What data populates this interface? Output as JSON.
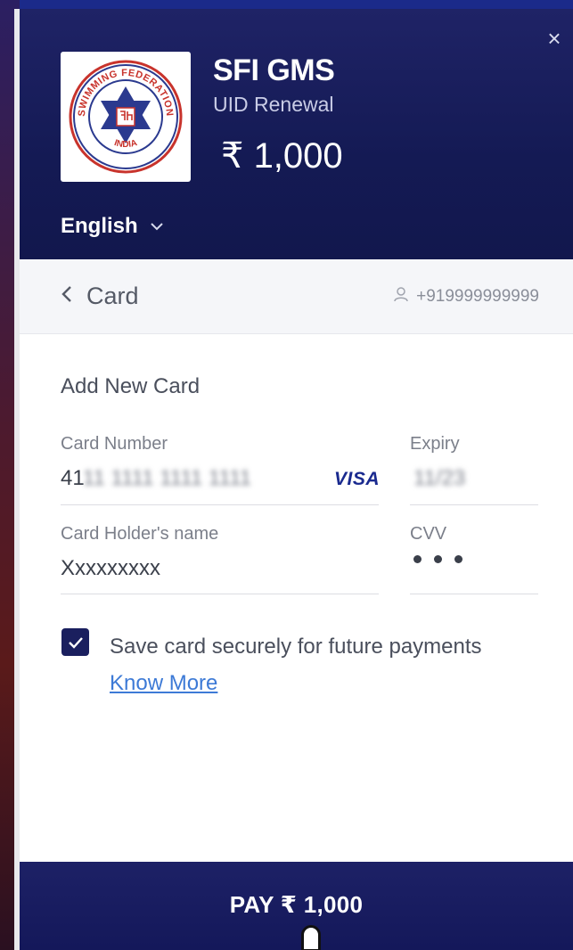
{
  "header": {
    "close_label": "×",
    "merchant_name": "SFI GMS",
    "merchant_desc": "UID Renewal",
    "amount": "₹ 1,000",
    "logo": {
      "top_text": "SWIMMING FEDERATION",
      "bottom_text": "INDIA"
    },
    "language": "English"
  },
  "method_bar": {
    "title": "Card",
    "contact": "+919999999999"
  },
  "form": {
    "section_title": "Add New Card",
    "card_number_label": "Card Number",
    "card_number_prefix": "41",
    "card_number_masked": "11 1111 1111 1111",
    "card_brand": "VISA",
    "expiry_label": "Expiry",
    "expiry_value": "11/23",
    "holder_label": "Card Holder's name",
    "holder_value": "Xxxxxxxxx",
    "cvv_label": "CVV",
    "save_card_text": "Save card securely for future payments",
    "save_card_checked": true,
    "know_more": "Know More"
  },
  "pay_button": {
    "label": "PAY ₹ 1,000"
  },
  "colors": {
    "header_bg": "#141a54",
    "accent": "#1a1f5e",
    "link": "#3d7ad6",
    "visa": "#1a2a8f"
  }
}
